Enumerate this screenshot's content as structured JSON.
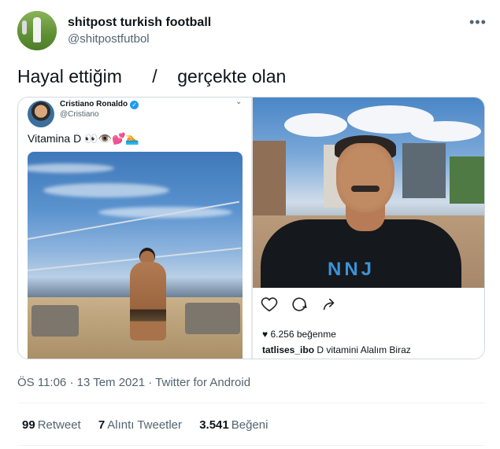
{
  "tweet": {
    "author_name": "shitpost turkish football",
    "author_handle": "@shitpostfutbol",
    "more_icon": "more-dots-icon",
    "text_left": "Hayal ettiğim",
    "text_sep": "/",
    "text_right": "gerçekte olan",
    "timestamp": "ÖS 11:06",
    "date": "13 Tem 2021",
    "source": "Twitter for Android",
    "dot": "·"
  },
  "embedded_tweet": {
    "name": "Cristiano Ronaldo",
    "handle": "@Cristiano",
    "text": "Vitamina D 👀👁️💕🏊",
    "verified_icon": "verified-badge-icon"
  },
  "instagram_post": {
    "likes": "6.256 beğenme",
    "username": "tatlises_ibo",
    "caption": "D vitamini Alalım Biraz",
    "shirt_text": "NNJ",
    "icons": [
      "heart-icon",
      "comment-icon",
      "share-icon"
    ]
  },
  "stats": {
    "retweets_count": "99",
    "retweets_label": "Retweet",
    "quotes_count": "7",
    "quotes_label": "Alıntı Tweetler",
    "likes_count": "3.541",
    "likes_label": "Beğeni"
  },
  "colors": {
    "text_primary": "#0f1419",
    "text_secondary": "#536471",
    "verified_blue": "#1d9bf0",
    "border": "#cfd9de"
  }
}
